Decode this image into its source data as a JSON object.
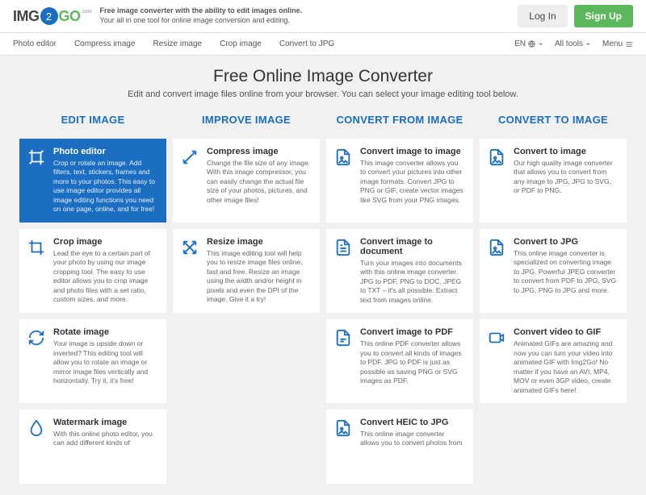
{
  "header": {
    "logo": {
      "img": "IMG",
      "two": "2",
      "go": "GO",
      "com": ".com"
    },
    "tagline1": "Free image converter with the ability to edit images online.",
    "tagline2": "Your all in one tool for online image conversion and editing.",
    "login": "Log In",
    "signup": "Sign Up"
  },
  "nav": {
    "items": [
      "Photo editor",
      "Compress image",
      "Resize image",
      "Crop image",
      "Convert to JPG"
    ],
    "lang": "EN",
    "alltools": "All tools",
    "menu": "Menu"
  },
  "main": {
    "title": "Free Online Image Converter",
    "subtitle": "Edit and convert image files online from your browser. You can select your image editing tool below."
  },
  "columns": [
    {
      "header": "EDIT IMAGE",
      "cards": [
        {
          "icon": "crop-rotate",
          "title": "Photo editor",
          "desc": "Crop or rotate an image. Add filters, text, stickers, frames and more to your photos. This easy to use image editor provides all image editing functions you need on one page, online, and for free!",
          "active": true
        },
        {
          "icon": "crop",
          "title": "Crop image",
          "desc": "Lead the eye to a certain part of your photo by using our image cropping tool. The easy to use editor allows you to crop image and photo files with a set ratio, custom sizes, and more."
        },
        {
          "icon": "rotate",
          "title": "Rotate image",
          "desc": "Your image is upside down or inverted? This editing tool will allow you to rotate an image or mirror image files vertically and horizontally. Try it, it's free!"
        },
        {
          "icon": "drop",
          "title": "Watermark image",
          "desc": "With this online photo editor, you can add different kinds of"
        }
      ]
    },
    {
      "header": "IMPROVE IMAGE",
      "cards": [
        {
          "icon": "compress",
          "title": "Compress image",
          "desc": "Change the file size of any image. With this image compressor, you can easily change the actual file size of your photos, pictures, and other image files!"
        },
        {
          "icon": "resize",
          "title": "Resize image",
          "desc": "This image editing tool will help you to resize image files online, fast and free. Resize an image using the width and/or height in pixels and even the DPI of the image. Give it a try!"
        }
      ]
    },
    {
      "header": "CONVERT FROM IMAGE",
      "cards": [
        {
          "icon": "file-img",
          "title": "Convert image to image",
          "desc": "This image converter allows you to convert your pictures into other image formats. Convert JPG to PNG or GIF, create vector images like SVG from your PNG images."
        },
        {
          "icon": "file-doc",
          "title": "Convert image to document",
          "desc": "Turn your images into documents with this online image converter. JPG to PDF, PNG to DOC, JPEG to TXT – it's all possible. Extract text from images online."
        },
        {
          "icon": "file-pdf",
          "title": "Convert image to PDF",
          "desc": "This online PDF converter allows you to convert all kinds of images to PDF. JPG to PDF is just as possible as saving PNG or SVG images as PDF."
        },
        {
          "icon": "file-img",
          "title": "Convert HEIC to JPG",
          "desc": "This online image converter allows you to convert photos from"
        }
      ]
    },
    {
      "header": "CONVERT TO IMAGE",
      "cards": [
        {
          "icon": "file-img",
          "title": "Convert to image",
          "desc": "Our high quality image converter that allows you to convert from any image to JPG, JPG to SVG, or PDF to PNG."
        },
        {
          "icon": "file-img",
          "title": "Convert to JPG",
          "desc": "This online image converter is specialized on converting image to JPG. Powerful JPEG converter to convert from PDF to JPG, SVG to JPG, PNG to JPG and more."
        },
        {
          "icon": "video",
          "title": "Convert video to GIF",
          "desc": "Animated GIFs are amazing and now you can turn your video into animated GIF with Img2Go! No matter if you have an AVI, MP4, MOV or even 3GP video, create animated GIFs here!"
        }
      ]
    }
  ]
}
